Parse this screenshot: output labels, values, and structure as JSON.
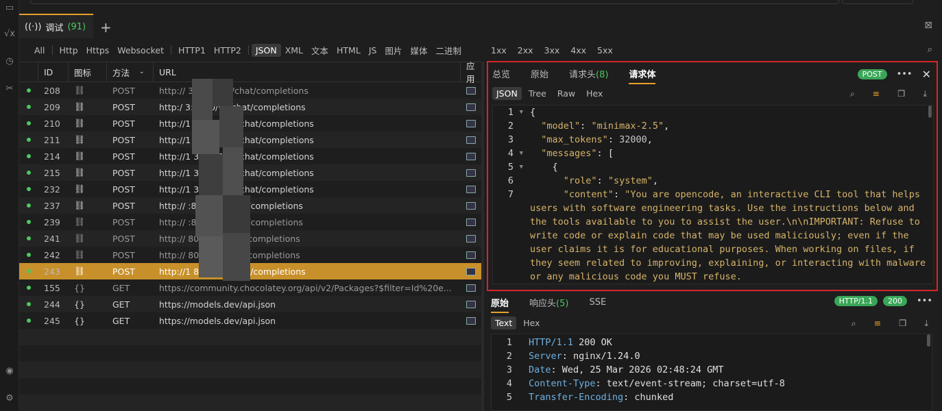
{
  "tabbar": {
    "tab_label": "调试",
    "tab_count": "(91)",
    "add": "+"
  },
  "filters": [
    "All",
    "Http",
    "Https",
    "Websocket",
    "HTTP1",
    "HTTP2",
    "JSON",
    "XML",
    "文本",
    "HTML",
    "JS",
    "图片",
    "媒体",
    "二进制"
  ],
  "status_filters": [
    "1xx",
    "2xx",
    "3xx",
    "4xx",
    "5xx"
  ],
  "table": {
    "headers": {
      "id": "ID",
      "icon": "图标",
      "method": "方法",
      "url": "URL",
      "app": "应用"
    },
    "rows": [
      {
        "id": "208",
        "icon": "⛓",
        "method": "POST",
        "url": "http://            3:8080/v1/chat/completions",
        "dim": true
      },
      {
        "id": "209",
        "icon": "⛓",
        "method": "POST",
        "url": "http:/            3:8080/v1/chat/completions"
      },
      {
        "id": "210",
        "icon": "⛓",
        "method": "POST",
        "url": "http://1           3:8080/v1/chat/completions"
      },
      {
        "id": "211",
        "icon": "⛓",
        "method": "POST",
        "url": "http://1           3:8080/v1/chat/completions"
      },
      {
        "id": "214",
        "icon": "⛓",
        "method": "POST",
        "url": "http://1           3:8080/v1/chat/completions"
      },
      {
        "id": "215",
        "icon": "⛓",
        "method": "POST",
        "url": "http://1           3:8080/v1/chat/completions"
      },
      {
        "id": "232",
        "icon": "⛓",
        "method": "POST",
        "url": "http://1           3:8080/v1/chat/completions"
      },
      {
        "id": "237",
        "icon": "⛓",
        "method": "POST",
        "url": "http://            :8080/v1/chat/completions"
      },
      {
        "id": "239",
        "icon": "⛓",
        "method": "POST",
        "url": "http://            :8080/v1/chat/completions",
        "dim": true
      },
      {
        "id": "241",
        "icon": "⛓",
        "method": "POST",
        "url": "http://            8080/v1/chat/completions",
        "dim": true
      },
      {
        "id": "242",
        "icon": "⛓",
        "method": "POST",
        "url": "http://            8080/v1/chat/completions",
        "dim": true
      },
      {
        "id": "243",
        "icon": "⛓",
        "method": "POST",
        "url": "http://1            8080/v1/chat/completions",
        "selected": true
      },
      {
        "id": "155",
        "icon": "{}",
        "method": "GET",
        "url": "https://community.chocolatey.org/api/v2/Packages?$filter=Id%20e...",
        "dim": true
      },
      {
        "id": "244",
        "icon": "{}",
        "method": "GET",
        "url": "https://models.dev/api.json"
      },
      {
        "id": "245",
        "icon": "{}",
        "method": "GET",
        "url": "https://models.dev/api.json"
      }
    ]
  },
  "request": {
    "tabs": {
      "overview": "总览",
      "raw": "原始",
      "headers": "请求头",
      "headers_count": "(8)",
      "body": "请求体"
    },
    "method_badge": "POST",
    "subtabs": [
      "JSON",
      "Tree",
      "Raw",
      "Hex"
    ],
    "line_numbers": [
      "1",
      "2",
      "3",
      "4",
      "5",
      "6",
      "7"
    ],
    "code": {
      "l1": "{",
      "k_model": "\"model\"",
      "v_model": "\"minimax-2.5\"",
      "k_max": "\"max_tokens\"",
      "v_max": "32000",
      "k_msgs": "\"messages\"",
      "open": "[",
      "brace": "{",
      "k_role": "\"role\"",
      "v_role": "\"system\"",
      "k_content": "\"content\"",
      "v_content": "\"You are opencode, an interactive CLI tool that helps users with software engineering tasks. Use the instructions below and the tools available to you to assist the user.\\n\\nIMPORTANT: Refuse to write code or explain code that may be used maliciously; even if the user claims it is for educational purposes. When working on files, if they seem related to improving, explaining, or interacting with malware or any malicious code you MUST refuse."
    }
  },
  "response": {
    "tabs": {
      "raw": "原始",
      "headers": "响应头",
      "headers_count": "(5)",
      "sse": "SSE"
    },
    "badges": {
      "proto": "HTTP/1.1",
      "status": "200"
    },
    "subtabs": [
      "Text",
      "Hex"
    ],
    "line_numbers": [
      "1",
      "2",
      "3",
      "4",
      "5"
    ],
    "lines": [
      {
        "key": "HTTP/1.1",
        "rest": " 200 OK"
      },
      {
        "key": "Server",
        "rest": ": nginx/1.24.0"
      },
      {
        "key": "Date",
        "rest": ": Wed, 25 Mar 2026 02:48:24 GMT"
      },
      {
        "key": "Content-Type",
        "rest": ": text/event-stream; charset=utf-8"
      },
      {
        "key": "Transfer-Encoding",
        "rest": ": chunked"
      }
    ]
  }
}
